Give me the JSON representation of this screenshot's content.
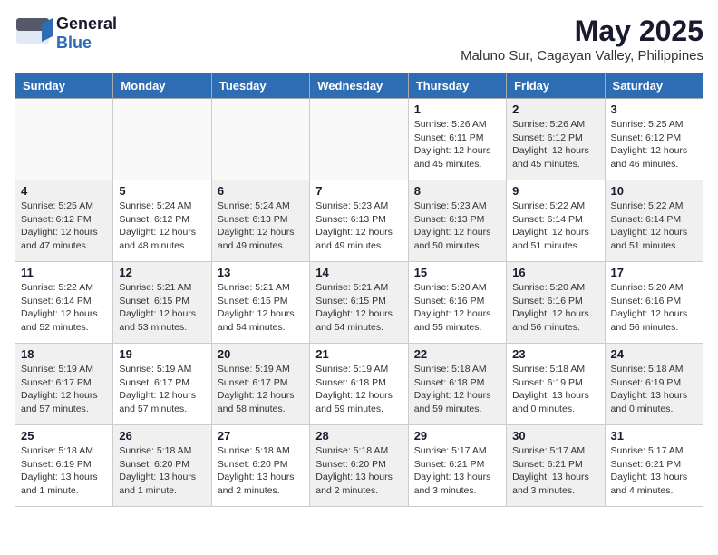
{
  "header": {
    "logo_general": "General",
    "logo_blue": "Blue",
    "title": "May 2025",
    "subtitle": "Maluno Sur, Cagayan Valley, Philippines"
  },
  "weekdays": [
    "Sunday",
    "Monday",
    "Tuesday",
    "Wednesday",
    "Thursday",
    "Friday",
    "Saturday"
  ],
  "weeks": [
    [
      {
        "day": "",
        "info": "",
        "shade": "empty"
      },
      {
        "day": "",
        "info": "",
        "shade": "empty"
      },
      {
        "day": "",
        "info": "",
        "shade": "empty"
      },
      {
        "day": "",
        "info": "",
        "shade": "empty"
      },
      {
        "day": "1",
        "info": "Sunrise: 5:26 AM\nSunset: 6:11 PM\nDaylight: 12 hours\nand 45 minutes.",
        "shade": ""
      },
      {
        "day": "2",
        "info": "Sunrise: 5:26 AM\nSunset: 6:12 PM\nDaylight: 12 hours\nand 45 minutes.",
        "shade": "shaded"
      },
      {
        "day": "3",
        "info": "Sunrise: 5:25 AM\nSunset: 6:12 PM\nDaylight: 12 hours\nand 46 minutes.",
        "shade": ""
      }
    ],
    [
      {
        "day": "4",
        "info": "Sunrise: 5:25 AM\nSunset: 6:12 PM\nDaylight: 12 hours\nand 47 minutes.",
        "shade": "shaded"
      },
      {
        "day": "5",
        "info": "Sunrise: 5:24 AM\nSunset: 6:12 PM\nDaylight: 12 hours\nand 48 minutes.",
        "shade": ""
      },
      {
        "day": "6",
        "info": "Sunrise: 5:24 AM\nSunset: 6:13 PM\nDaylight: 12 hours\nand 49 minutes.",
        "shade": "shaded"
      },
      {
        "day": "7",
        "info": "Sunrise: 5:23 AM\nSunset: 6:13 PM\nDaylight: 12 hours\nand 49 minutes.",
        "shade": ""
      },
      {
        "day": "8",
        "info": "Sunrise: 5:23 AM\nSunset: 6:13 PM\nDaylight: 12 hours\nand 50 minutes.",
        "shade": "shaded"
      },
      {
        "day": "9",
        "info": "Sunrise: 5:22 AM\nSunset: 6:14 PM\nDaylight: 12 hours\nand 51 minutes.",
        "shade": ""
      },
      {
        "day": "10",
        "info": "Sunrise: 5:22 AM\nSunset: 6:14 PM\nDaylight: 12 hours\nand 51 minutes.",
        "shade": "shaded"
      }
    ],
    [
      {
        "day": "11",
        "info": "Sunrise: 5:22 AM\nSunset: 6:14 PM\nDaylight: 12 hours\nand 52 minutes.",
        "shade": ""
      },
      {
        "day": "12",
        "info": "Sunrise: 5:21 AM\nSunset: 6:15 PM\nDaylight: 12 hours\nand 53 minutes.",
        "shade": "shaded"
      },
      {
        "day": "13",
        "info": "Sunrise: 5:21 AM\nSunset: 6:15 PM\nDaylight: 12 hours\nand 54 minutes.",
        "shade": ""
      },
      {
        "day": "14",
        "info": "Sunrise: 5:21 AM\nSunset: 6:15 PM\nDaylight: 12 hours\nand 54 minutes.",
        "shade": "shaded"
      },
      {
        "day": "15",
        "info": "Sunrise: 5:20 AM\nSunset: 6:16 PM\nDaylight: 12 hours\nand 55 minutes.",
        "shade": ""
      },
      {
        "day": "16",
        "info": "Sunrise: 5:20 AM\nSunset: 6:16 PM\nDaylight: 12 hours\nand 56 minutes.",
        "shade": "shaded"
      },
      {
        "day": "17",
        "info": "Sunrise: 5:20 AM\nSunset: 6:16 PM\nDaylight: 12 hours\nand 56 minutes.",
        "shade": ""
      }
    ],
    [
      {
        "day": "18",
        "info": "Sunrise: 5:19 AM\nSunset: 6:17 PM\nDaylight: 12 hours\nand 57 minutes.",
        "shade": "shaded"
      },
      {
        "day": "19",
        "info": "Sunrise: 5:19 AM\nSunset: 6:17 PM\nDaylight: 12 hours\nand 57 minutes.",
        "shade": ""
      },
      {
        "day": "20",
        "info": "Sunrise: 5:19 AM\nSunset: 6:17 PM\nDaylight: 12 hours\nand 58 minutes.",
        "shade": "shaded"
      },
      {
        "day": "21",
        "info": "Sunrise: 5:19 AM\nSunset: 6:18 PM\nDaylight: 12 hours\nand 59 minutes.",
        "shade": ""
      },
      {
        "day": "22",
        "info": "Sunrise: 5:18 AM\nSunset: 6:18 PM\nDaylight: 12 hours\nand 59 minutes.",
        "shade": "shaded"
      },
      {
        "day": "23",
        "info": "Sunrise: 5:18 AM\nSunset: 6:19 PM\nDaylight: 13 hours\nand 0 minutes.",
        "shade": ""
      },
      {
        "day": "24",
        "info": "Sunrise: 5:18 AM\nSunset: 6:19 PM\nDaylight: 13 hours\nand 0 minutes.",
        "shade": "shaded"
      }
    ],
    [
      {
        "day": "25",
        "info": "Sunrise: 5:18 AM\nSunset: 6:19 PM\nDaylight: 13 hours\nand 1 minute.",
        "shade": ""
      },
      {
        "day": "26",
        "info": "Sunrise: 5:18 AM\nSunset: 6:20 PM\nDaylight: 13 hours\nand 1 minute.",
        "shade": "shaded"
      },
      {
        "day": "27",
        "info": "Sunrise: 5:18 AM\nSunset: 6:20 PM\nDaylight: 13 hours\nand 2 minutes.",
        "shade": ""
      },
      {
        "day": "28",
        "info": "Sunrise: 5:18 AM\nSunset: 6:20 PM\nDaylight: 13 hours\nand 2 minutes.",
        "shade": "shaded"
      },
      {
        "day": "29",
        "info": "Sunrise: 5:17 AM\nSunset: 6:21 PM\nDaylight: 13 hours\nand 3 minutes.",
        "shade": ""
      },
      {
        "day": "30",
        "info": "Sunrise: 5:17 AM\nSunset: 6:21 PM\nDaylight: 13 hours\nand 3 minutes.",
        "shade": "shaded"
      },
      {
        "day": "31",
        "info": "Sunrise: 5:17 AM\nSunset: 6:21 PM\nDaylight: 13 hours\nand 4 minutes.",
        "shade": ""
      }
    ]
  ]
}
